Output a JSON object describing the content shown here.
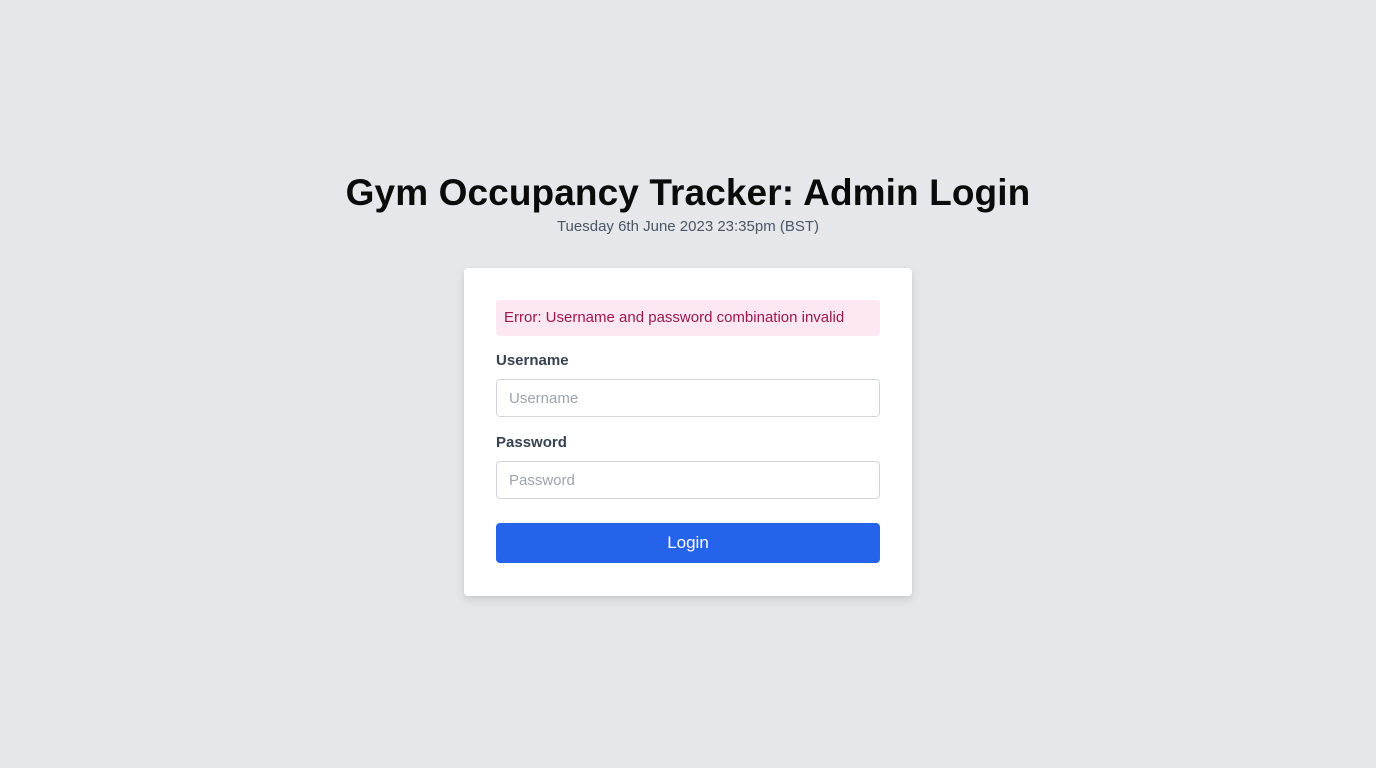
{
  "header": {
    "title": "Gym Occupancy Tracker: Admin Login",
    "datetime": "Tuesday 6th June 2023 23:35pm (BST)"
  },
  "login": {
    "error": "Error: Username and password combination invalid",
    "username_label": "Username",
    "username_placeholder": "Username",
    "username_value": "",
    "password_label": "Password",
    "password_placeholder": "Password",
    "password_value": "",
    "submit_label": "Login"
  },
  "colors": {
    "background": "#e5e7eb",
    "accent": "#2563eb",
    "error_bg": "#fce7f3",
    "error_text": "#9d174d"
  }
}
